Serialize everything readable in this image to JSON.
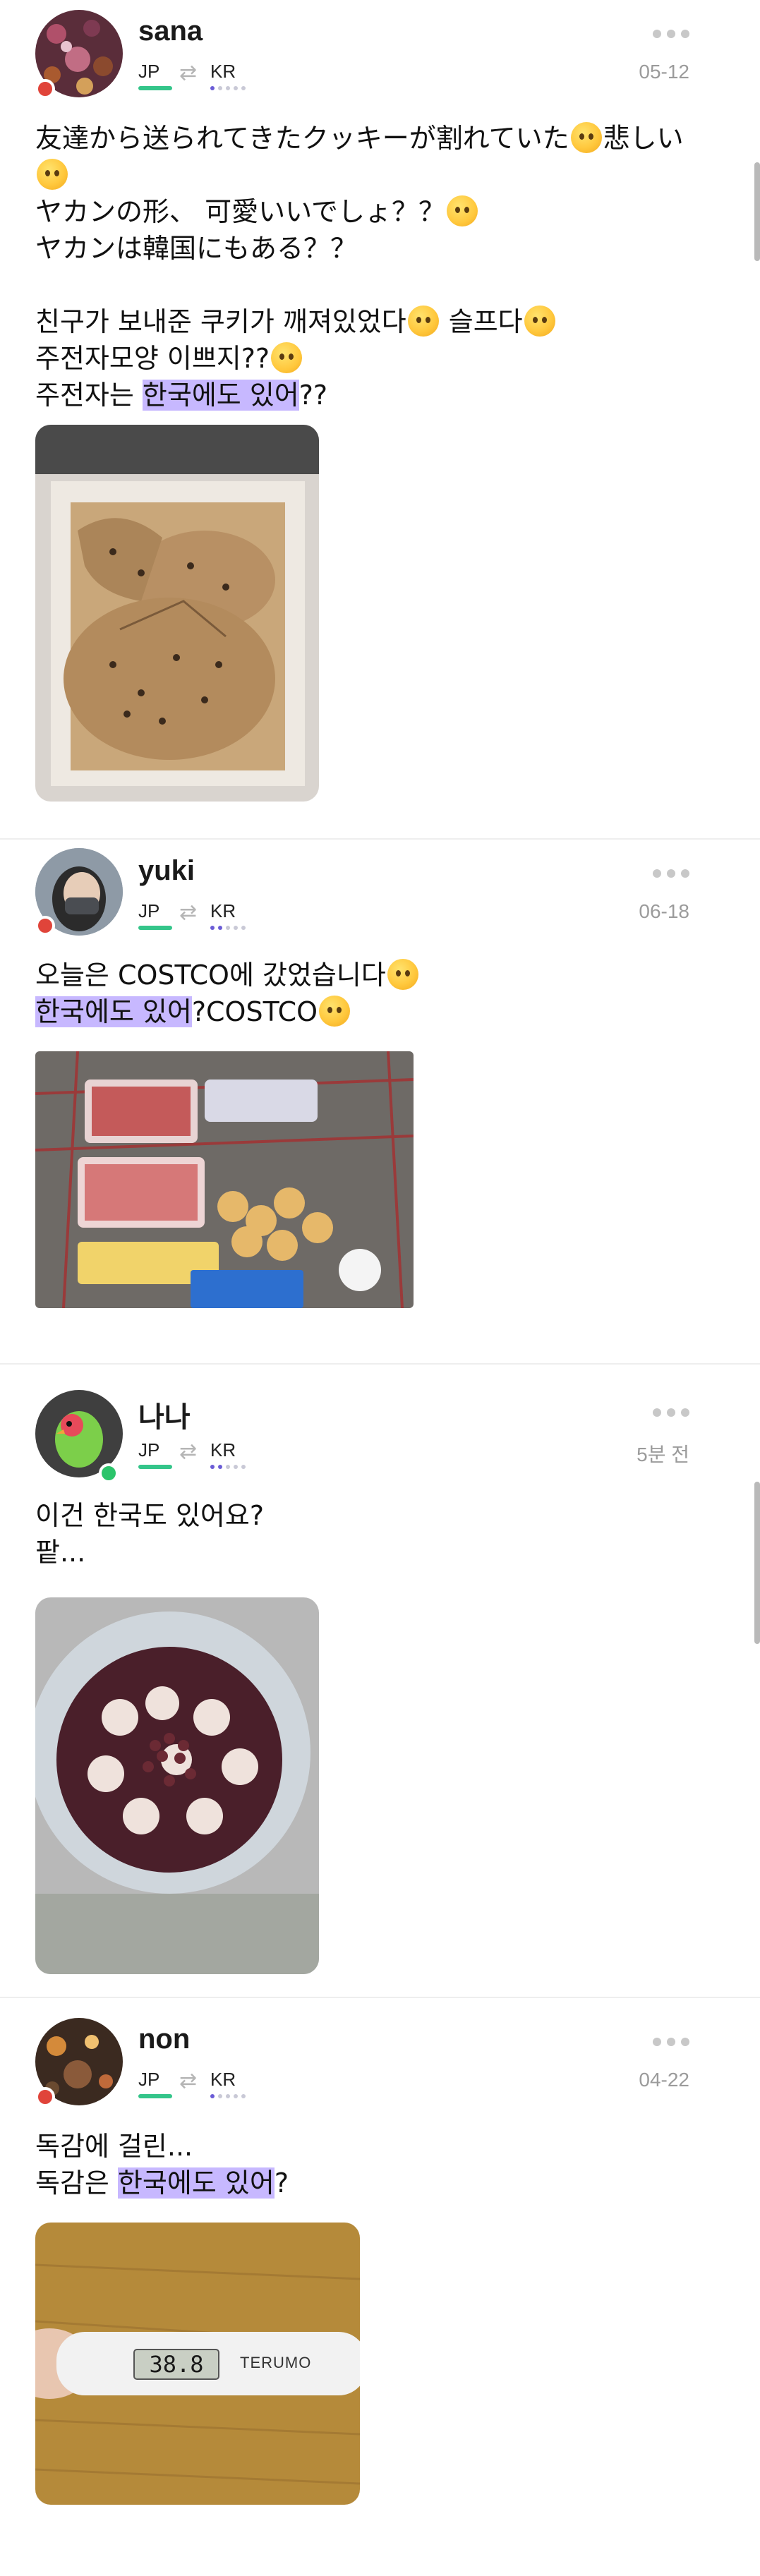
{
  "posts": [
    {
      "username": "sana",
      "lang_from": "JP",
      "lang_to": "KR",
      "date": "05-12",
      "lines": [
        {
          "text": "友達から送られてきたクッキーが割れていた",
          "emoji": "crying-face",
          "after": "悲しい"
        },
        {
          "text": "",
          "emoji": "pleading-face",
          "after": ""
        },
        {
          "text": "ヤカンの形、 可愛いいでしょ？？",
          "emoji": "smiling-face-with-hearts",
          "after": ""
        },
        {
          "text": "ヤカンは韓国にもある？？",
          "emoji": "",
          "after": ""
        },
        {
          "text": "",
          "emoji": "",
          "after": ""
        },
        {
          "text": "친구가 보내준 쿠키가 깨져있었다",
          "emoji": "crying-face",
          "after": " 슬프다"
        },
        {
          "text": "주전자모양 이쁘지??",
          "emoji": "smiling-face-with-hearts",
          "after": ""
        },
        {
          "text": "주전자는 ",
          "highlight": "한국에도 있어",
          "after": "??"
        }
      ],
      "image": "cracked-cookie-in-box"
    },
    {
      "username": "yuki",
      "lang_from": "JP",
      "lang_to": "KR",
      "date": "06-18",
      "lines": [
        {
          "text": "오늘은 COSTCO에 갔었습니다",
          "emoji": "grinning-face",
          "after": ""
        },
        {
          "text": "",
          "highlight": "한국에도 있어",
          "after": "?COSTCO",
          "emoji_end": "smiling-face"
        }
      ],
      "image": "costco-shopping-cart"
    },
    {
      "username": "나나",
      "lang_from": "JP",
      "lang_to": "KR",
      "date": "5분 전",
      "lines": [
        {
          "text": "이건 한국도 있어요?"
        },
        {
          "text": "팥..."
        }
      ],
      "image": "red-bean-soup-bowl"
    },
    {
      "username": "non",
      "lang_from": "JP",
      "lang_to": "KR",
      "date": "04-22",
      "lines": [
        {
          "text": "독감에 걸린..."
        },
        {
          "text": "독감은 ",
          "highlight": "한국에도 있어",
          "after": "?"
        }
      ],
      "image": "thermometer",
      "thermometer_reading": "38.8",
      "thermometer_brand": "TERUMO"
    }
  ],
  "colors": {
    "highlight": "#c7b8ff",
    "jp_bar": "#34c58a",
    "kr_dot": "#6b5cd6",
    "presence_red": "#e0443a",
    "presence_green": "#2bc46a"
  }
}
